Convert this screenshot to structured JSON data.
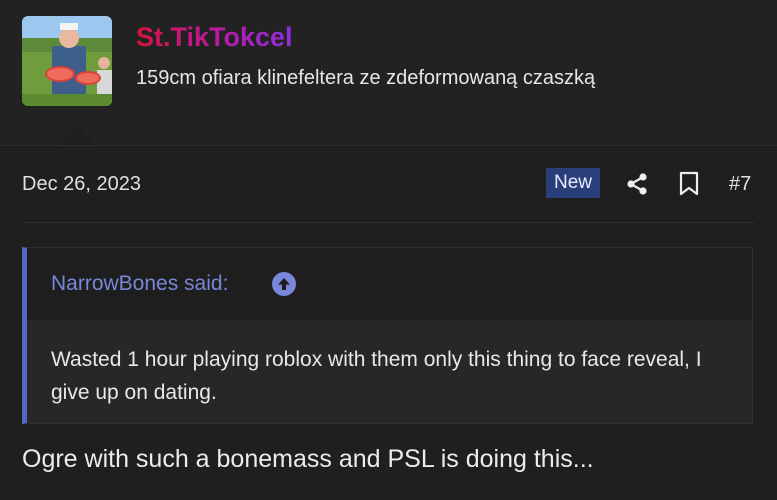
{
  "user": {
    "name": "St.TikTokcel",
    "title": "159cm ofiara klinefeltera ze zdeformowaną czaszką"
  },
  "post": {
    "date": "Dec 26, 2023",
    "badge": "New",
    "number": "#7",
    "message": "Ogre with such a bonemass and PSL is doing this..."
  },
  "quote": {
    "author_line": "NarrowBones said:",
    "text": "Wasted 1 hour playing roblox with them only this thing to face reveal, I give up on dating."
  },
  "icons": {
    "share": "share-icon",
    "bookmark": "bookmark-icon",
    "quote_jump": "arrow-up-circle-icon"
  },
  "colors": {
    "background": "#1f1f1f",
    "username_gradient": [
      "#d8123e",
      "#8e2ee0"
    ],
    "quote_accent": "#5667c8",
    "badge_bg": "#2a3f7a"
  }
}
